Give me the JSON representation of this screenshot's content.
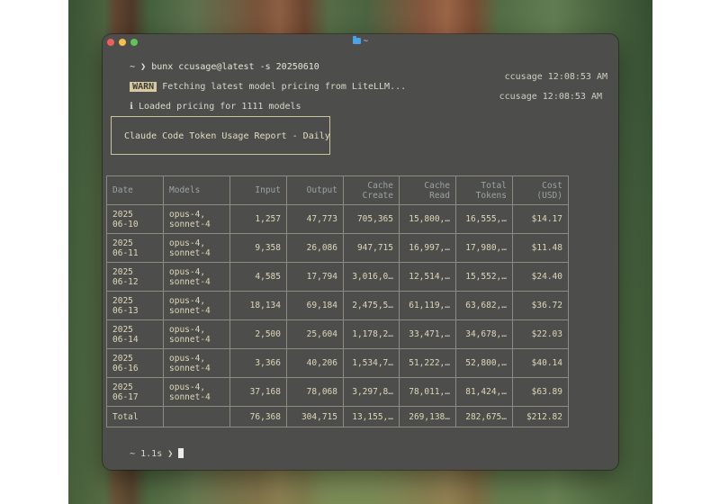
{
  "window": {
    "title": "~"
  },
  "terminal": {
    "prompt_symbol": "~ ❯",
    "command": "bunx ccusage@latest -s 20250610",
    "warn_badge": "WARN",
    "warn_message": "Fetching latest model pricing from LiteLLM...",
    "warn_time": "ccusage 12:08:53 AM",
    "info_symbol": "ℹ",
    "info_message": "Loaded pricing for 1111 models",
    "info_time": "ccusage 12:08:53 AM",
    "report_title": "Claude Code Token Usage Report - Daily",
    "end_prompt": "~ 1.1s ❯"
  },
  "table": {
    "headers": [
      [
        "Date"
      ],
      [
        "Models"
      ],
      [
        "Input"
      ],
      [
        "Output"
      ],
      [
        "Cache",
        "Create"
      ],
      [
        "Cache",
        "Read"
      ],
      [
        "Total",
        "Tokens"
      ],
      [
        "Cost",
        "(USD)"
      ]
    ],
    "rows": [
      {
        "date": [
          "2025",
          "06-10"
        ],
        "models": [
          "opus-4,",
          "sonnet-4"
        ],
        "input": "1,257",
        "output": "47,773",
        "cache_create": "705,365",
        "cache_read": "15,800,…",
        "total": "16,555,…",
        "cost": "$14.17"
      },
      {
        "date": [
          "2025",
          "06-11"
        ],
        "models": [
          "opus-4,",
          "sonnet-4"
        ],
        "input": "9,358",
        "output": "26,086",
        "cache_create": "947,715",
        "cache_read": "16,997,…",
        "total": "17,980,…",
        "cost": "$11.48"
      },
      {
        "date": [
          "2025",
          "06-12"
        ],
        "models": [
          "opus-4,",
          "sonnet-4"
        ],
        "input": "4,585",
        "output": "17,794",
        "cache_create": "3,016,0…",
        "cache_read": "12,514,…",
        "total": "15,552,…",
        "cost": "$24.40"
      },
      {
        "date": [
          "2025",
          "06-13"
        ],
        "models": [
          "opus-4,",
          "sonnet-4"
        ],
        "input": "18,134",
        "output": "69,184",
        "cache_create": "2,475,5…",
        "cache_read": "61,119,…",
        "total": "63,682,…",
        "cost": "$36.72"
      },
      {
        "date": [
          "2025",
          "06-14"
        ],
        "models": [
          "opus-4,",
          "sonnet-4"
        ],
        "input": "2,500",
        "output": "25,604",
        "cache_create": "1,178,2…",
        "cache_read": "33,471,…",
        "total": "34,678,…",
        "cost": "$22.03"
      },
      {
        "date": [
          "2025",
          "06-16"
        ],
        "models": [
          "opus-4,",
          "sonnet-4"
        ],
        "input": "3,366",
        "output": "40,206",
        "cache_create": "1,534,7…",
        "cache_read": "51,222,…",
        "total": "52,800,…",
        "cost": "$40.14"
      },
      {
        "date": [
          "2025",
          "06-17"
        ],
        "models": [
          "opus-4,",
          "sonnet-4"
        ],
        "input": "37,168",
        "output": "78,068",
        "cache_create": "3,297,8…",
        "cache_read": "78,011,…",
        "total": "81,424,…",
        "cost": "$63.89"
      }
    ],
    "total": {
      "label": "Total",
      "models": "",
      "input": "76,368",
      "output": "304,715",
      "cache_create": "13,155,…",
      "cache_read": "269,138…",
      "total": "282,675…",
      "cost": "$212.82"
    }
  },
  "colors": {
    "window_bg": "#4d4d4b",
    "warn_badge": "#d9c9a0",
    "text": "#ded8b8",
    "header": "#9aa3a5"
  }
}
